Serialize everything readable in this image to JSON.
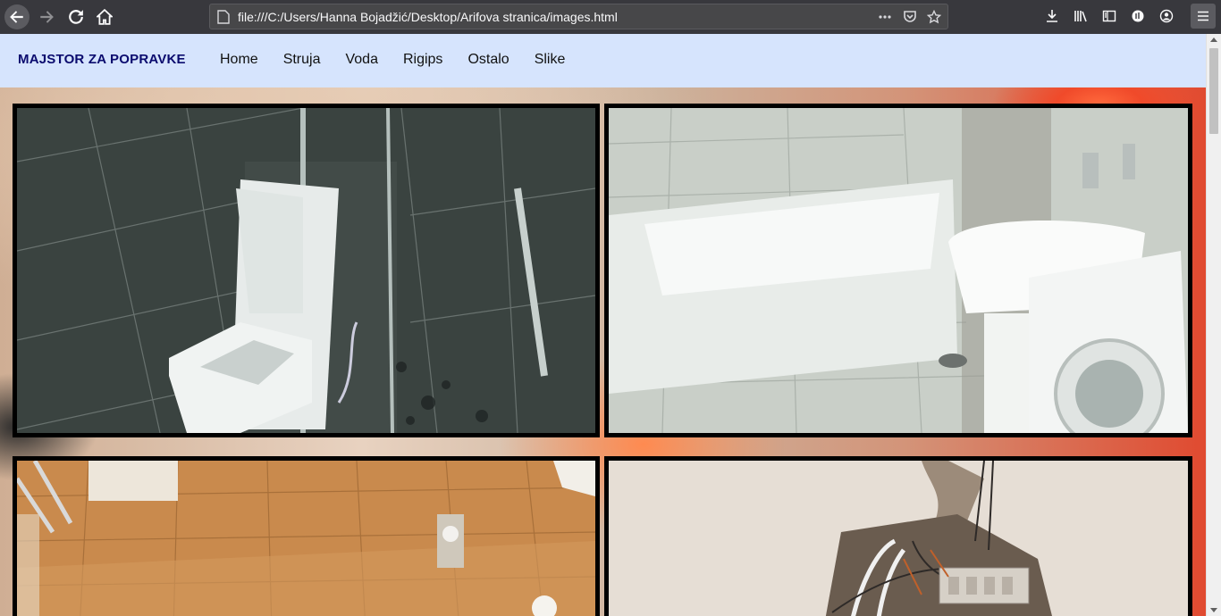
{
  "browser": {
    "url": "file:///C:/Users/Hanna Bojadžić/Desktop/Arifova stranica/images.html",
    "icons": [
      "back-icon",
      "forward-icon",
      "reload-icon",
      "home-icon",
      "page-icon",
      "more-icon",
      "pocket-icon",
      "bookmark-star-icon",
      "download-icon",
      "library-icon",
      "sidebar-icon",
      "extension-icon",
      "account-icon",
      "menu-icon"
    ]
  },
  "site": {
    "brand": "MAJSTOR ZA POPRAVKE",
    "nav": [
      "Home",
      "Struja",
      "Voda",
      "Rigips",
      "Ostalo",
      "Slike"
    ]
  },
  "gallery": {
    "photos": [
      "shower-toilet-photo",
      "bathtub-sink-washer-photo",
      "orange-tiled-bathroom-photo",
      "electrical-wiring-photo"
    ]
  },
  "colors": {
    "navbar_bg": "#d6e4fd",
    "brand_color": "#0b0b6e",
    "chrome_bg": "#38383d",
    "photo_border": "#000000"
  }
}
